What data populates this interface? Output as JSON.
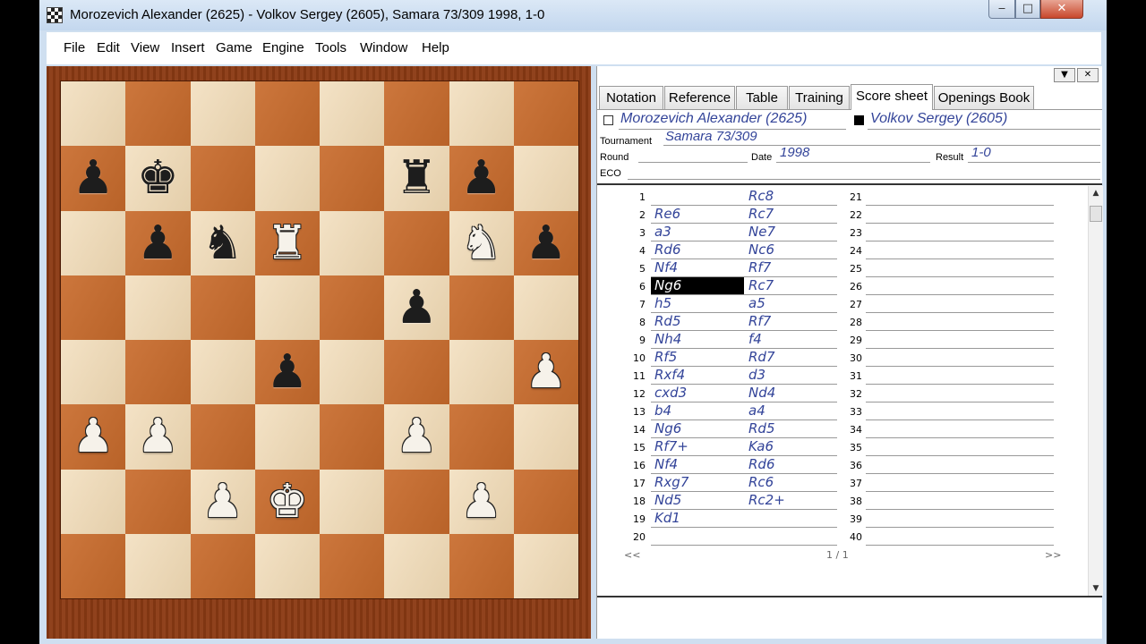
{
  "window": {
    "title": "Morozevich Alexander (2625) - Volkov Sergey (2605), Samara 73/309 1998, 1-0",
    "minimize": "‒",
    "maximize": "□",
    "close": "✕"
  },
  "menu": [
    {
      "label": "File"
    },
    {
      "label": "Edit"
    },
    {
      "label": "View"
    },
    {
      "label": "Insert"
    },
    {
      "label": "Game"
    },
    {
      "label": "Engine"
    },
    {
      "label": "Tools"
    },
    {
      "label": "Window"
    },
    {
      "label": "Help"
    }
  ],
  "panel_controls": {
    "dropdown": "▼",
    "close": "✕"
  },
  "tabs": [
    {
      "label": "Notation",
      "active": false
    },
    {
      "label": "Reference",
      "active": false
    },
    {
      "label": "Table",
      "active": false
    },
    {
      "label": "Training",
      "active": false
    },
    {
      "label": "Score sheet",
      "active": true
    },
    {
      "label": "Openings Book",
      "active": false
    }
  ],
  "game": {
    "white": "Morozevich Alexander (2625)",
    "black": "Volkov Sergey (2605)",
    "tournament_label": "Tournament",
    "tournament": "Samara 73/309",
    "round_label": "Round",
    "round": "",
    "date_label": "Date",
    "date": "1998",
    "result_label": "Result",
    "result": "1-0",
    "eco_label": "ECO",
    "eco": ""
  },
  "board": {
    "pieces": [
      {
        "sq": "a7",
        "glyph": "♟",
        "color": "b"
      },
      {
        "sq": "b7",
        "glyph": "♚",
        "color": "b"
      },
      {
        "sq": "f7",
        "glyph": "♜",
        "color": "b"
      },
      {
        "sq": "g7",
        "glyph": "♟",
        "color": "b"
      },
      {
        "sq": "b6",
        "glyph": "♟",
        "color": "b"
      },
      {
        "sq": "c6",
        "glyph": "♞",
        "color": "b"
      },
      {
        "sq": "d6",
        "glyph": "♜",
        "color": "w"
      },
      {
        "sq": "g6",
        "glyph": "♞",
        "color": "w"
      },
      {
        "sq": "h6",
        "glyph": "♟",
        "color": "b"
      },
      {
        "sq": "f5",
        "glyph": "♟",
        "color": "b"
      },
      {
        "sq": "d4",
        "glyph": "♟",
        "color": "b"
      },
      {
        "sq": "h4",
        "glyph": "♟",
        "color": "w"
      },
      {
        "sq": "a3",
        "glyph": "♟",
        "color": "w"
      },
      {
        "sq": "b3",
        "glyph": "♟",
        "color": "w"
      },
      {
        "sq": "f3",
        "glyph": "♟",
        "color": "w"
      },
      {
        "sq": "c2",
        "glyph": "♟",
        "color": "w"
      },
      {
        "sq": "d2",
        "glyph": "♚",
        "color": "w"
      },
      {
        "sq": "g2",
        "glyph": "♟",
        "color": "w"
      }
    ]
  },
  "scoresheet": {
    "moves": [
      [
        "",
        "Rc8"
      ],
      [
        "Re6",
        "Rc7"
      ],
      [
        "a3",
        "Ne7"
      ],
      [
        "Rd6",
        "Nc6"
      ],
      [
        "Nf4",
        "Rf7"
      ],
      [
        "Ng6",
        "Rc7"
      ],
      [
        "h5",
        "a5"
      ],
      [
        "Rd5",
        "Rf7"
      ],
      [
        "Nh4",
        "f4"
      ],
      [
        "Rf5",
        "Rd7"
      ],
      [
        "Rxf4",
        "d3"
      ],
      [
        "cxd3",
        "Nd4"
      ],
      [
        "b4",
        "a4"
      ],
      [
        "Ng6",
        "Rd5"
      ],
      [
        "Rf7+",
        "Ka6"
      ],
      [
        "Nf4",
        "Rd6"
      ],
      [
        "Rxg7",
        "Rc6"
      ],
      [
        "Nd5",
        "Rc2+"
      ],
      [
        "Kd1",
        ""
      ],
      [
        "",
        ""
      ]
    ],
    "highlight": {
      "move": 6,
      "side": 0
    },
    "right_numbers": [
      "21",
      "22",
      "23",
      "24",
      "25",
      "26",
      "27",
      "28",
      "29",
      "30",
      "31",
      "32",
      "33",
      "34",
      "35",
      "36",
      "37",
      "38",
      "39",
      "40"
    ],
    "left_numbers": [
      "1",
      "2",
      "3",
      "4",
      "5",
      "6",
      "7",
      "8",
      "9",
      "10",
      "11",
      "12",
      "13",
      "14",
      "15",
      "16",
      "17",
      "18",
      "19",
      "20"
    ],
    "pager": {
      "prev": "<<",
      "page": "1 / 1",
      "next": ">>"
    }
  },
  "scrollbar": {
    "up": "▲",
    "down": "▼"
  }
}
